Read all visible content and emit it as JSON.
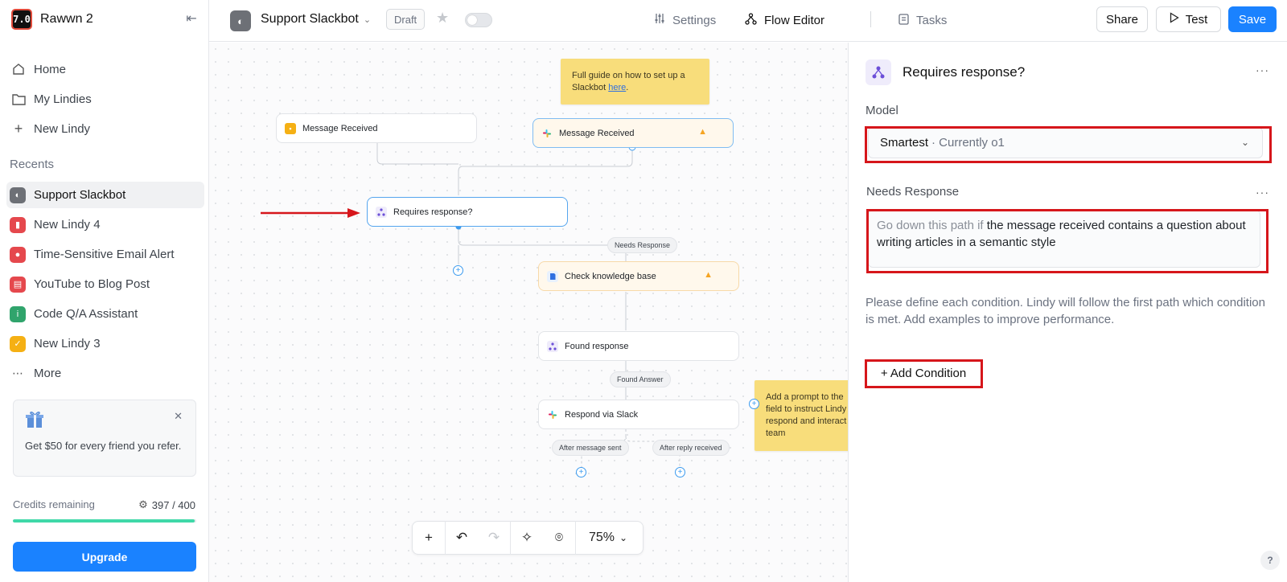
{
  "workspace": {
    "logo_text": "7.0",
    "name": "Rawwn 2"
  },
  "nav": [
    {
      "label": "Home",
      "icon": "home-icon"
    },
    {
      "label": "My Lindies",
      "icon": "folder-icon"
    },
    {
      "label": "New Lindy",
      "icon": "plus-icon"
    }
  ],
  "recents": {
    "label": "Recents",
    "items": [
      {
        "label": "Support Slackbot",
        "color": "#6d7076",
        "active": true
      },
      {
        "label": "New Lindy 4",
        "color": "#e5484d"
      },
      {
        "label": "Time-Sensitive Email Alert",
        "color": "#e5484d"
      },
      {
        "label": "YouTube to Blog Post",
        "color": "#e5484d"
      },
      {
        "label": "Code Q/A Assistant",
        "color": "#30a46c"
      },
      {
        "label": "New Lindy 3",
        "color": "#f5b014"
      }
    ],
    "more_label": "More"
  },
  "promo": {
    "text": "Get $50 for every friend you refer."
  },
  "credits": {
    "label": "Credits remaining",
    "value": "397 / 400",
    "used": 397,
    "total": 400,
    "color": "#3fd8a8"
  },
  "upgrade_label": "Upgrade",
  "topbar": {
    "agent_name": "Support Slackbot",
    "status_badge": "Draft",
    "tabs": [
      {
        "label": "Settings",
        "icon": "sliders-icon"
      },
      {
        "label": "Flow Editor",
        "icon": "flow-icon",
        "active": true
      },
      {
        "label": "Tasks",
        "icon": "clipboard-icon"
      }
    ],
    "share_label": "Share",
    "test_label": "Test",
    "save_label": "Save"
  },
  "canvas": {
    "note_top": {
      "text": "Full guide on how to set up a Slackbot ",
      "link": "here",
      "after": "."
    },
    "note_right": "Add a prompt to the field to instruct Lindy respond and interact team",
    "nodes": {
      "trigger_a": "Message Received",
      "trigger_b": "Message Received",
      "condition": "Requires response?",
      "check_kb": "Check knowledge base",
      "found": "Found response",
      "respond": "Respond via Slack"
    },
    "edge_labels": {
      "needs_response": "Needs Response",
      "found_answer": "Found Answer",
      "after_sent": "After message sent",
      "after_reply": "After reply received"
    },
    "zoom": "75%"
  },
  "panel": {
    "title": "Requires response?",
    "model_label": "Model",
    "model_value": "Smartest",
    "model_sub": "· Currently o1",
    "condition_label": "Needs Response",
    "condition_prefix": "Go down this path if",
    "condition_text": " the message received contains a question about writing articles in a semantic style",
    "help_text": "Please define each condition. Lindy will follow the first path which condition is met. Add examples to improve performance.",
    "add_condition_label": "+ Add Condition"
  },
  "annotation_color": "#d6161b"
}
